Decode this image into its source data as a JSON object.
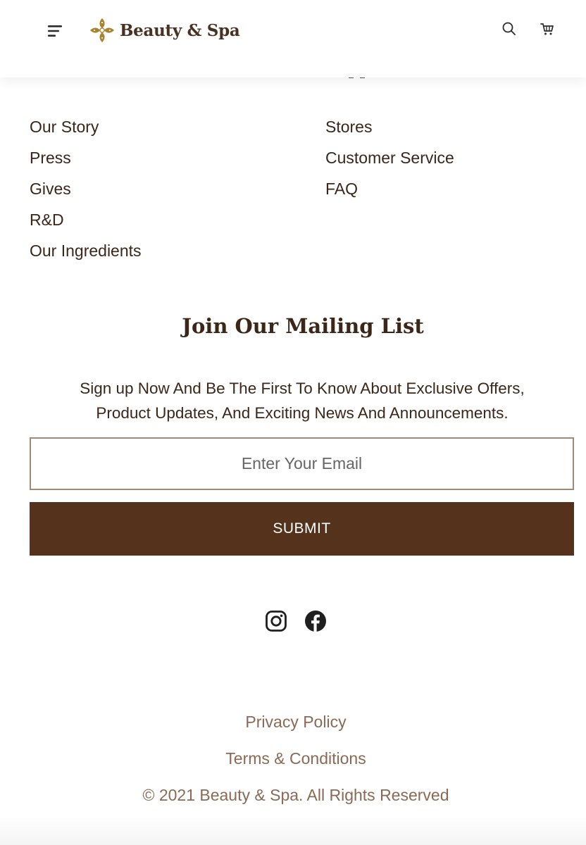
{
  "header": {
    "brand": "Beauty & Spa",
    "icons": {
      "menu": "menu-icon",
      "logo": "flower-logo-icon",
      "search": "search-icon",
      "cart": "cart-icon"
    }
  },
  "footer_links": {
    "left": [
      "Our Story",
      "Press",
      "Gives",
      "R&D",
      "Our Ingredients"
    ],
    "right": [
      "Stores",
      "Customer Service",
      "FAQ"
    ]
  },
  "mailing": {
    "title": "Join Our Mailing List",
    "line1": "Sign up Now And Be The First To Know About Exclusive Offers,",
    "line2": "Product Updates, And Exciting News And Announcements.",
    "email_value": "",
    "email_placeholder": "Enter Your Email",
    "submit_label": "SUBMIT"
  },
  "social": {
    "icons": [
      "instagram-icon",
      "facebook-icon"
    ]
  },
  "legal": {
    "privacy": "Privacy Policy",
    "terms": "Terms & Conditions",
    "copyright": "© 2021 Beauty & Spa. All Rights Reserved"
  },
  "colors": {
    "brand_brown": "#55321b",
    "text_dark": "#3b2618",
    "text_muted": "#8a6a55",
    "logo_gold": "#a9842f",
    "input_border": "#a28a78"
  }
}
